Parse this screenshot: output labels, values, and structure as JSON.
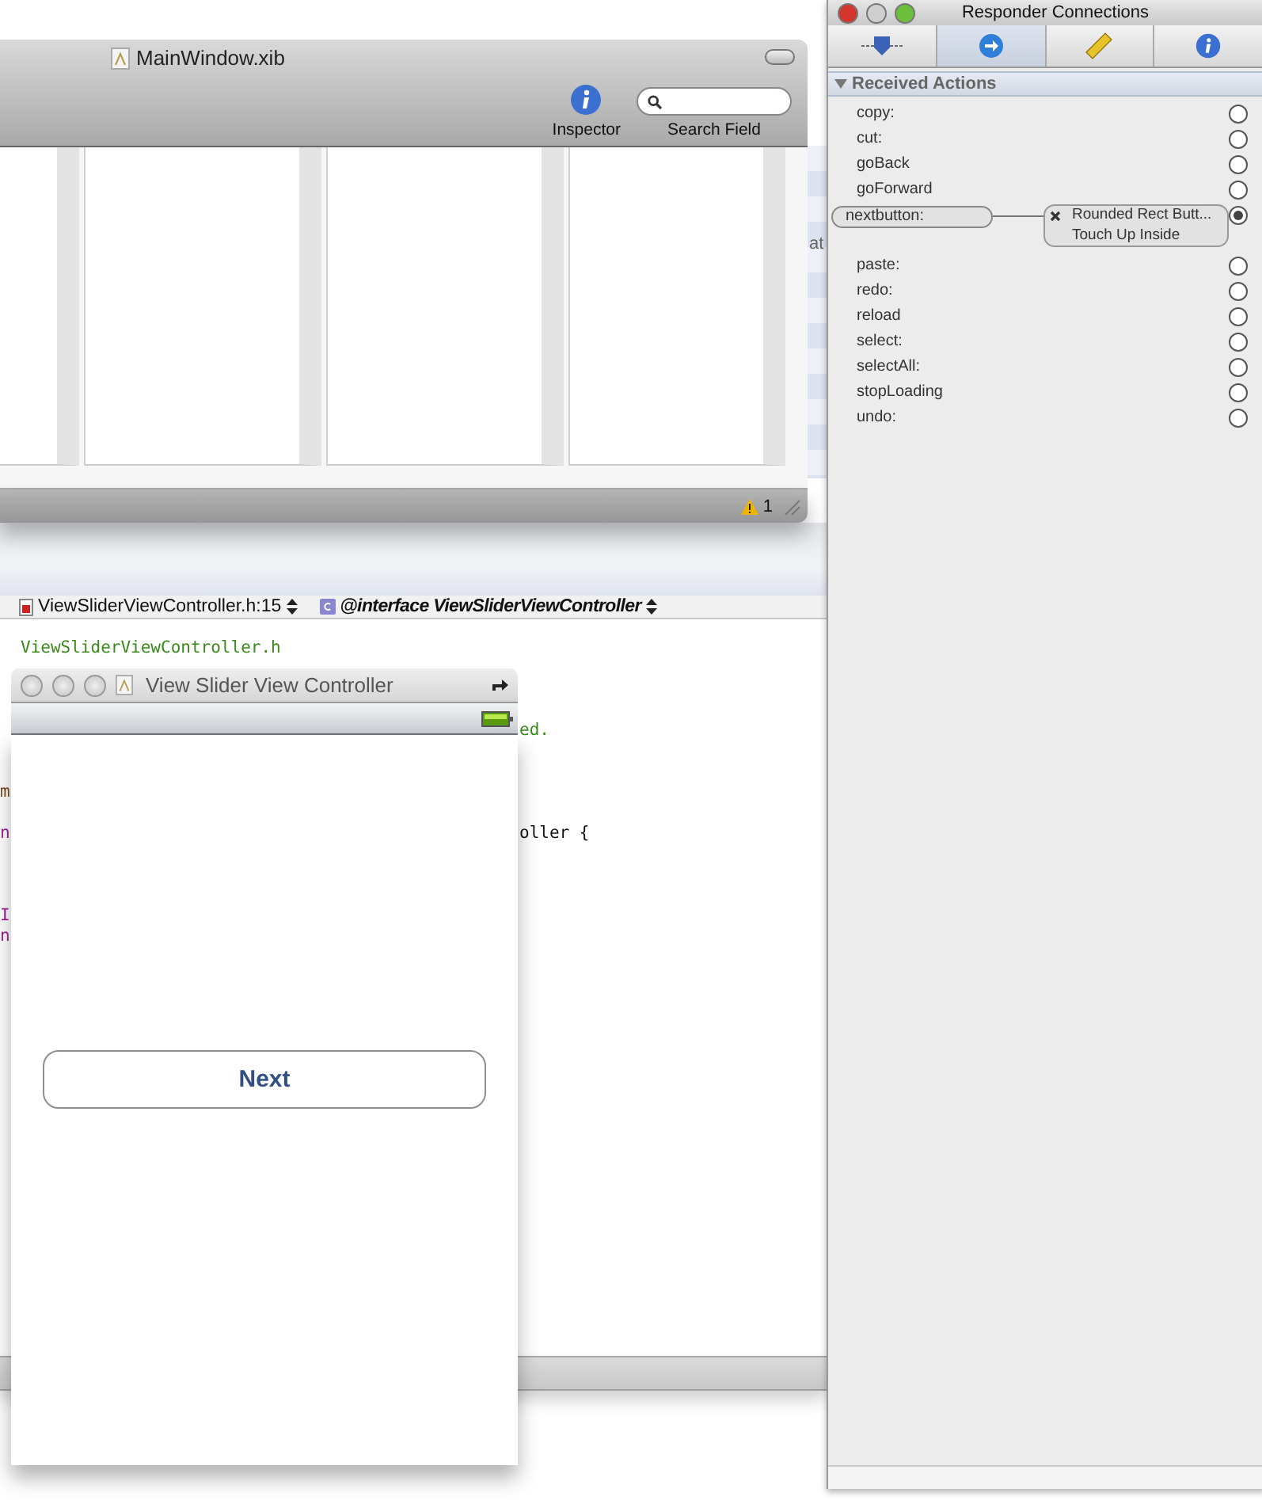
{
  "xib_window": {
    "title": "MainWindow.xib",
    "toolbar": [
      {
        "kind": "info",
        "label": "Inspector"
      },
      {
        "kind": "search",
        "label": "Search Field"
      }
    ],
    "warning_count": "1"
  },
  "background_fragment": "at",
  "editor": {
    "file_menu": "ViewSliderViewController.h:15",
    "symbol_menu": "@interface ViewSliderViewController",
    "lines": [
      {
        "left": {
          "text": "ViewSliderViewController.h",
          "kind": "comment"
        }
      },
      {
        "right": {
          "text": "ed.",
          "kind": "comment"
        }
      },
      {
        "left": {
          "text": "m",
          "kind": "directive"
        }
      },
      {
        "left": {
          "text": "n",
          "kind": "keyword"
        },
        "right": {
          "text": "oller {",
          "kind": "plain"
        }
      },
      {
        "left": {
          "text": "I",
          "kind": "keyword"
        }
      },
      {
        "left": {
          "text": "n",
          "kind": "keyword"
        }
      }
    ]
  },
  "simulator": {
    "title": "View Slider View Controller",
    "button": "Next"
  },
  "inspector": {
    "title": "Responder Connections",
    "tabs": [
      {
        "kind": "identity",
        "selected": false
      },
      {
        "kind": "connections",
        "selected": true
      },
      {
        "kind": "size",
        "selected": false
      },
      {
        "kind": "info",
        "selected": false
      }
    ],
    "section": {
      "title": "Received Actions",
      "expanded": true
    },
    "actions": [
      {
        "name": "copy:",
        "connected": false
      },
      {
        "name": "cut:",
        "connected": false
      },
      {
        "name": "goBack",
        "connected": false
      },
      {
        "name": "goForward",
        "connected": false
      },
      {
        "name": "nextbutton:",
        "connected": true,
        "target": "Rounded Rect Butt...",
        "event": "Touch Up Inside"
      },
      {
        "name": "paste:",
        "connected": false
      },
      {
        "name": "redo:",
        "connected": false
      },
      {
        "name": "reload",
        "connected": false
      },
      {
        "name": "select:",
        "connected": false
      },
      {
        "name": "selectAll:",
        "connected": false
      },
      {
        "name": "stopLoading",
        "connected": false
      },
      {
        "name": "undo:",
        "connected": false
      }
    ]
  }
}
